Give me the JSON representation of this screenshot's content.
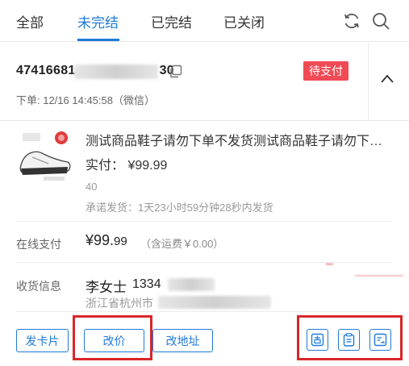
{
  "tabs": [
    {
      "label": "全部"
    },
    {
      "label": "未完结"
    },
    {
      "label": "已完结"
    },
    {
      "label": "已关闭"
    }
  ],
  "active_tab": "未完结",
  "toolbar_icons": [
    "refresh-icon",
    "search-icon"
  ],
  "order": {
    "number_prefix": "47416681",
    "number_suffix": "30",
    "time": "下单: 12/16 14:45:58（微信）",
    "status": "待支付",
    "status_color": "#f04a55"
  },
  "product": {
    "title": "测试商品鞋子请勿下单不发货测试商品鞋子请勿下单不发货",
    "price_label": "实付：",
    "price": "¥99.99",
    "quantity": "40",
    "ship_promise": "承诺发货：1天23小时59分钟28秒内发货"
  },
  "payment": {
    "label": "在线支付",
    "amount_major": "¥99.",
    "amount_minor": "99",
    "note": "（含运费￥0.00）"
  },
  "receiver": {
    "label": "收货信息",
    "name": "李女士",
    "phone_prefix": "1334",
    "address_prefix": "浙江省杭州市"
  },
  "buttons": {
    "send_card": "发卡片",
    "change_price": "改价",
    "change_address": "改地址"
  },
  "action_icons": [
    "note-icon",
    "clipboard-icon",
    "transfer-icon"
  ],
  "colors": {
    "accent": "#1f7ad8",
    "highlight": "#d8262a"
  }
}
